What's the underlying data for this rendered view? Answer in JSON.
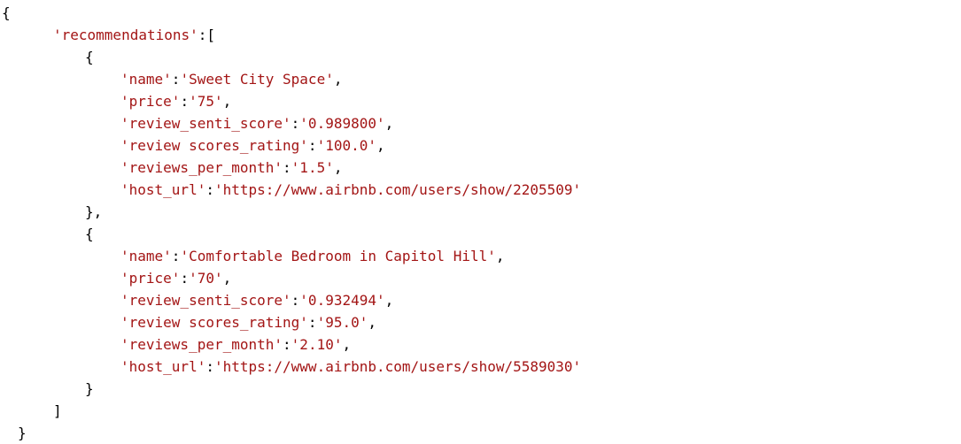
{
  "code": {
    "open_brace": "{",
    "close_brace": "}",
    "recommendations_key": "'recommendations'",
    "array_open": ":[",
    "array_close": "]",
    "item_open": "{",
    "item_close_comma": "},",
    "item_close": "}",
    "colon": ":",
    "comma": ",",
    "keys": {
      "name": "'name'",
      "price": "'price'",
      "review_senti_score": "'review_senti_score'",
      "review_scores_rating": "'review scores_rating'",
      "reviews_per_month": "'reviews_per_month'",
      "host_url": "'host_url'"
    },
    "items": [
      {
        "name": "'Sweet City Space'",
        "price": "'75'",
        "review_senti_score": "'0.989800'",
        "review_scores_rating": "'100.0'",
        "reviews_per_month": "'1.5'",
        "host_url": "'https://www.airbnb.com/users/show/2205509'"
      },
      {
        "name": "'Comfortable Bedroom in Capitol Hill'",
        "price": "'70'",
        "review_senti_score": "'0.932494'",
        "review_scores_rating": "'95.0'",
        "reviews_per_month": "'2.10'",
        "host_url": "'https://www.airbnb.com/users/show/5589030'"
      }
    ]
  }
}
